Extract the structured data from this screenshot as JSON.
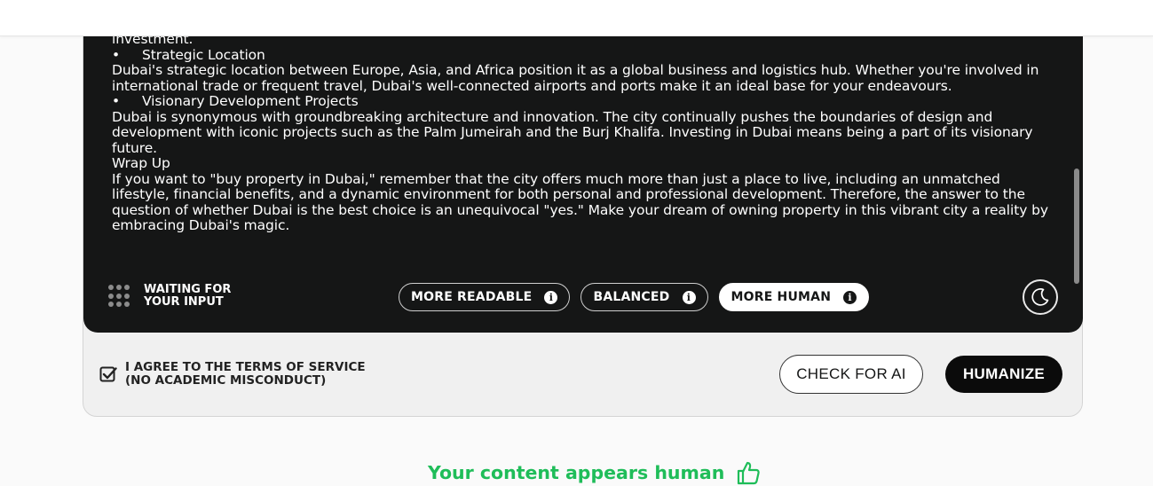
{
  "editor": {
    "lines": [
      {
        "type": "text",
        "text": "investment."
      },
      {
        "type": "bullet",
        "bullet": "•",
        "text": "Strategic Location"
      },
      {
        "type": "text",
        "text": "Dubai's strategic location between Europe, Asia, and Africa position it as a global business and logistics hub. Whether you're involved in international trade or frequent travel, Dubai's well-connected airports and ports make it an ideal base for your endeavours."
      },
      {
        "type": "bullet",
        "bullet": "•",
        "text": "Visionary Development Projects"
      },
      {
        "type": "text",
        "text": "Dubai is synonymous with groundbreaking architecture and innovation. The city continually pushes the boundaries of design and development with iconic projects such as the Palm Jumeirah and the Burj Khalifa. Investing in Dubai means being a part of its visionary future."
      },
      {
        "type": "text",
        "text": "Wrap Up"
      },
      {
        "type": "text",
        "text": "If you want to \"buy property in Dubai,\" remember that the city offers much more than just a place to live, including an unmatched lifestyle, financial benefits, and a dynamic environment for both personal and professional development. Therefore, the answer to the question of whether Dubai is the best choice is an unequivocal \"yes.\" Make your dream of owning property in this vibrant city a reality by embracing Dubai's magic."
      }
    ]
  },
  "status": {
    "line1": "WAITING FOR",
    "line2": "YOUR INPUT",
    "icon": "dots-grid-icon"
  },
  "modes": [
    {
      "label": "MORE READABLE",
      "active": false,
      "icon": "info-icon"
    },
    {
      "label": "BALANCED",
      "active": false,
      "icon": "info-icon"
    },
    {
      "label": "MORE HUMAN",
      "active": true,
      "icon": "info-icon"
    }
  ],
  "theme_toggle": {
    "icon": "moon-icon"
  },
  "agreement": {
    "line1": "I AGREE TO THE TERMS OF SERVICE",
    "line2": "(NO ACADEMIC MISCONDUCT)",
    "checked": true
  },
  "buttons": {
    "check_for_ai": "CHECK FOR AI",
    "humanize": "HUMANIZE"
  },
  "result": {
    "text": "Your content appears human",
    "icon": "thumbs-up-icon",
    "color": "#1fbd59"
  },
  "colors": {
    "editor_bg": "#151616",
    "page_bg": "#fafafa",
    "accent_green": "#1fbd59"
  }
}
